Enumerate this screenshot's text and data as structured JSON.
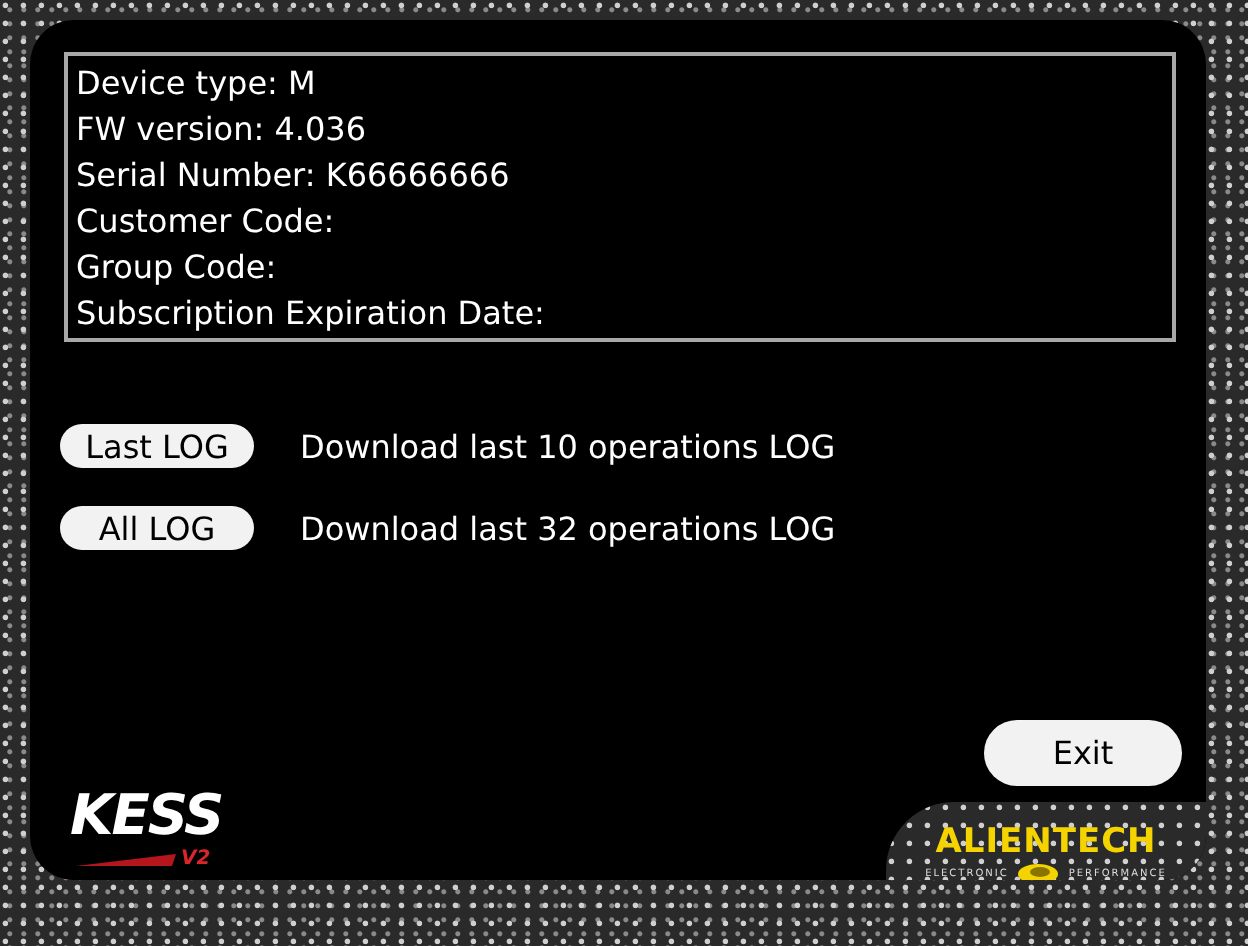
{
  "info_lines": [
    "Device type: M",
    "FW version: 4.036",
    "Serial Number: K66666666",
    "Customer Code:",
    "Group Code:",
    "Subscription Expiration Date:"
  ],
  "log_actions": [
    {
      "button": "Last LOG",
      "description": "Download last 10 operations LOG"
    },
    {
      "button": "All LOG",
      "description": "Download last 32 operations LOG"
    }
  ],
  "exit_button": "Exit",
  "logos": {
    "product": "KESS",
    "product_version": "V2",
    "brand": "ALIENTECH",
    "brand_tagline_left": "ELECTRONIC",
    "brand_tagline_right": "PERFORMANCE"
  }
}
